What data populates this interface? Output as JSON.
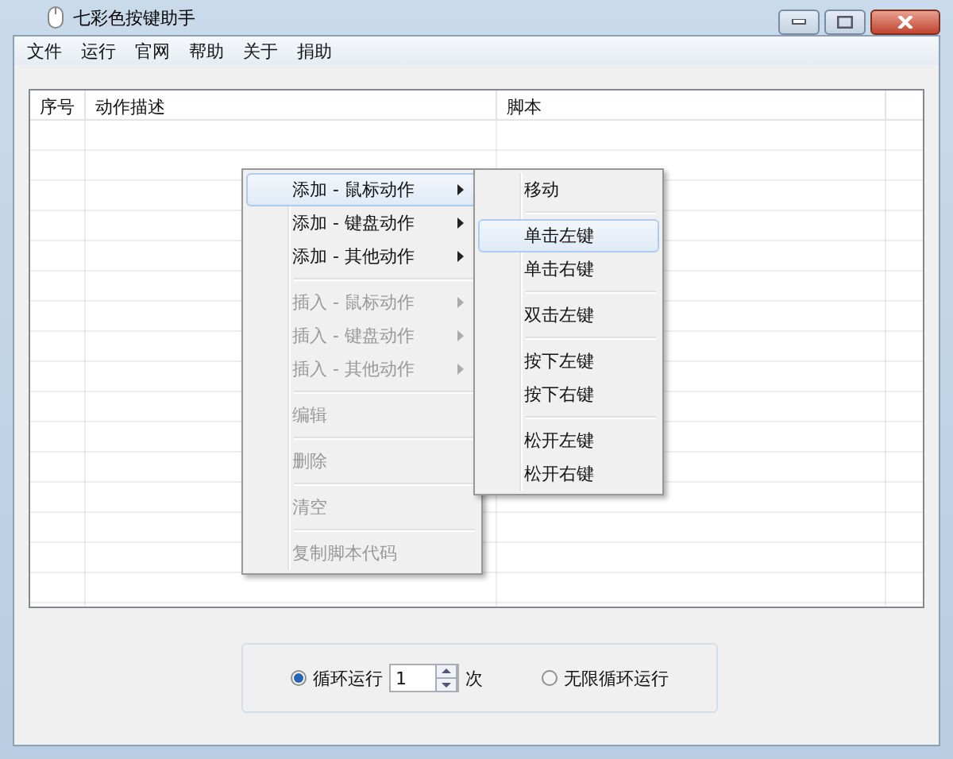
{
  "window": {
    "title": "七彩色按键助手"
  },
  "menu_bar": [
    "文件",
    "运行",
    "官网",
    "帮助",
    "关于",
    "捐助"
  ],
  "table": {
    "columns": [
      "序号",
      "动作描述",
      "脚本"
    ]
  },
  "context_menu": {
    "groups": [
      [
        {
          "label": "添加 - 鼠标动作",
          "submenu": true,
          "disabled": false,
          "selected": true
        },
        {
          "label": "添加 - 键盘动作",
          "submenu": true,
          "disabled": false,
          "selected": false
        },
        {
          "label": "添加 - 其他动作",
          "submenu": true,
          "disabled": false,
          "selected": false
        }
      ],
      [
        {
          "label": "插入 - 鼠标动作",
          "submenu": true,
          "disabled": true,
          "selected": false
        },
        {
          "label": "插入 - 键盘动作",
          "submenu": true,
          "disabled": true,
          "selected": false
        },
        {
          "label": "插入 - 其他动作",
          "submenu": true,
          "disabled": true,
          "selected": false
        }
      ],
      [
        {
          "label": "编辑",
          "submenu": false,
          "disabled": true,
          "selected": false
        }
      ],
      [
        {
          "label": "删除",
          "submenu": false,
          "disabled": true,
          "selected": false
        }
      ],
      [
        {
          "label": "清空",
          "submenu": false,
          "disabled": true,
          "selected": false
        }
      ],
      [
        {
          "label": "复制脚本代码",
          "submenu": false,
          "disabled": true,
          "selected": false
        }
      ]
    ]
  },
  "submenu": {
    "groups": [
      [
        {
          "label": "移动",
          "selected": false
        }
      ],
      [
        {
          "label": "单击左键",
          "selected": true
        },
        {
          "label": "单击右键",
          "selected": false
        }
      ],
      [
        {
          "label": "双击左键",
          "selected": false
        }
      ],
      [
        {
          "label": "按下左键",
          "selected": false
        },
        {
          "label": "按下右键",
          "selected": false
        }
      ],
      [
        {
          "label": "松开左键",
          "selected": false
        },
        {
          "label": "松开右键",
          "selected": false
        }
      ]
    ]
  },
  "loop_options": [
    {
      "kind": "count",
      "label": "循环运行",
      "selected": true,
      "value": "1",
      "unit": "次"
    },
    {
      "kind": "infinite",
      "label": "无限循环运行",
      "selected": false
    }
  ]
}
